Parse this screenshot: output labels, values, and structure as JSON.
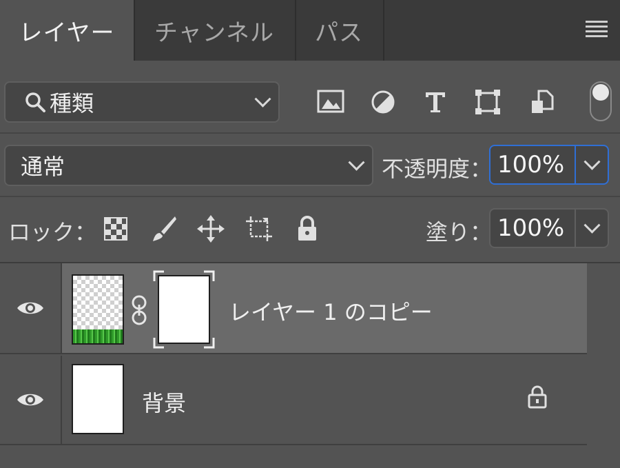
{
  "tabs": [
    {
      "label": "レイヤー",
      "active": true
    },
    {
      "label": "チャンネル",
      "active": false
    },
    {
      "label": "パス",
      "active": false
    }
  ],
  "filter": {
    "kind_label": "種類",
    "icons": [
      "image-filter-icon",
      "adjustment-filter-icon",
      "type-filter-icon",
      "shape-filter-icon",
      "smart-object-filter-icon"
    ]
  },
  "blend": {
    "mode": "通常",
    "opacity_label": "不透明度：",
    "opacity_value": "100%"
  },
  "lock": {
    "label": "ロック：",
    "fill_label": "塗り：",
    "fill_value": "100%"
  },
  "layers": [
    {
      "name": "レイヤー 1 のコピー",
      "selected": true,
      "visible": true
    },
    {
      "name": "背景",
      "selected": false,
      "visible": true,
      "locked": true
    }
  ],
  "colors": {
    "panel": "#535353",
    "tabbar": "#3a3a3a",
    "selected_row": "#6a6a6a",
    "focus": "#2f6fd6"
  }
}
